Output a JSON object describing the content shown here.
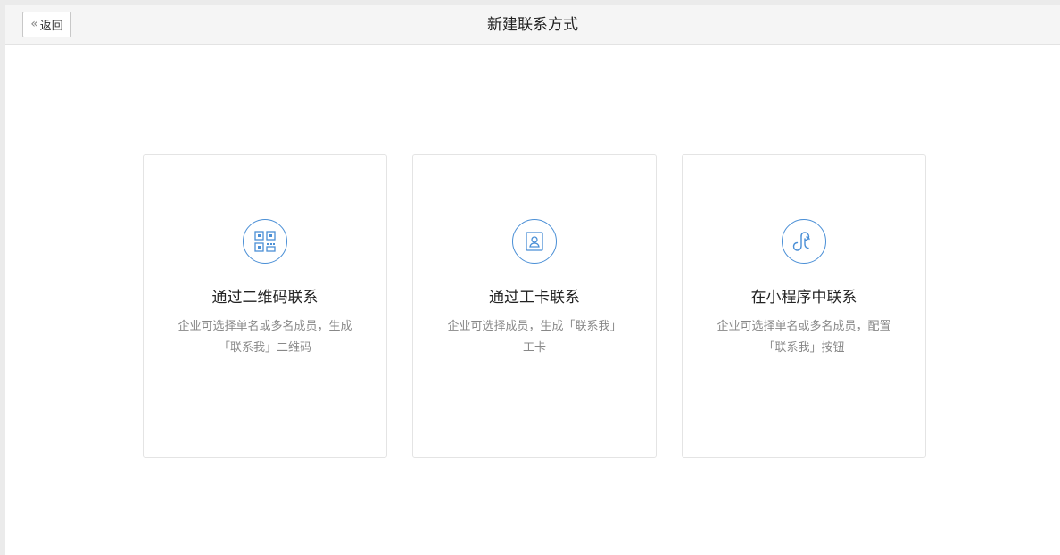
{
  "header": {
    "back_label": "返回",
    "title": "新建联系方式"
  },
  "cards": [
    {
      "icon": "qr-code-icon",
      "title": "通过二维码联系",
      "desc_line1": "企业可选择单名或多名成员，生成",
      "desc_line2": "「联系我」二维码"
    },
    {
      "icon": "badge-card-icon",
      "title": "通过工卡联系",
      "desc_line1": "企业可选择成员，生成「联系我」",
      "desc_line2": "工卡"
    },
    {
      "icon": "mini-program-icon",
      "title": "在小程序中联系",
      "desc_line1": "企业可选择单名或多名成员，配置",
      "desc_line2": "「联系我」按钮"
    }
  ],
  "colors": {
    "accent": "#4a8fd6",
    "header_bg": "#f5f5f5",
    "desc_text": "#888888"
  }
}
